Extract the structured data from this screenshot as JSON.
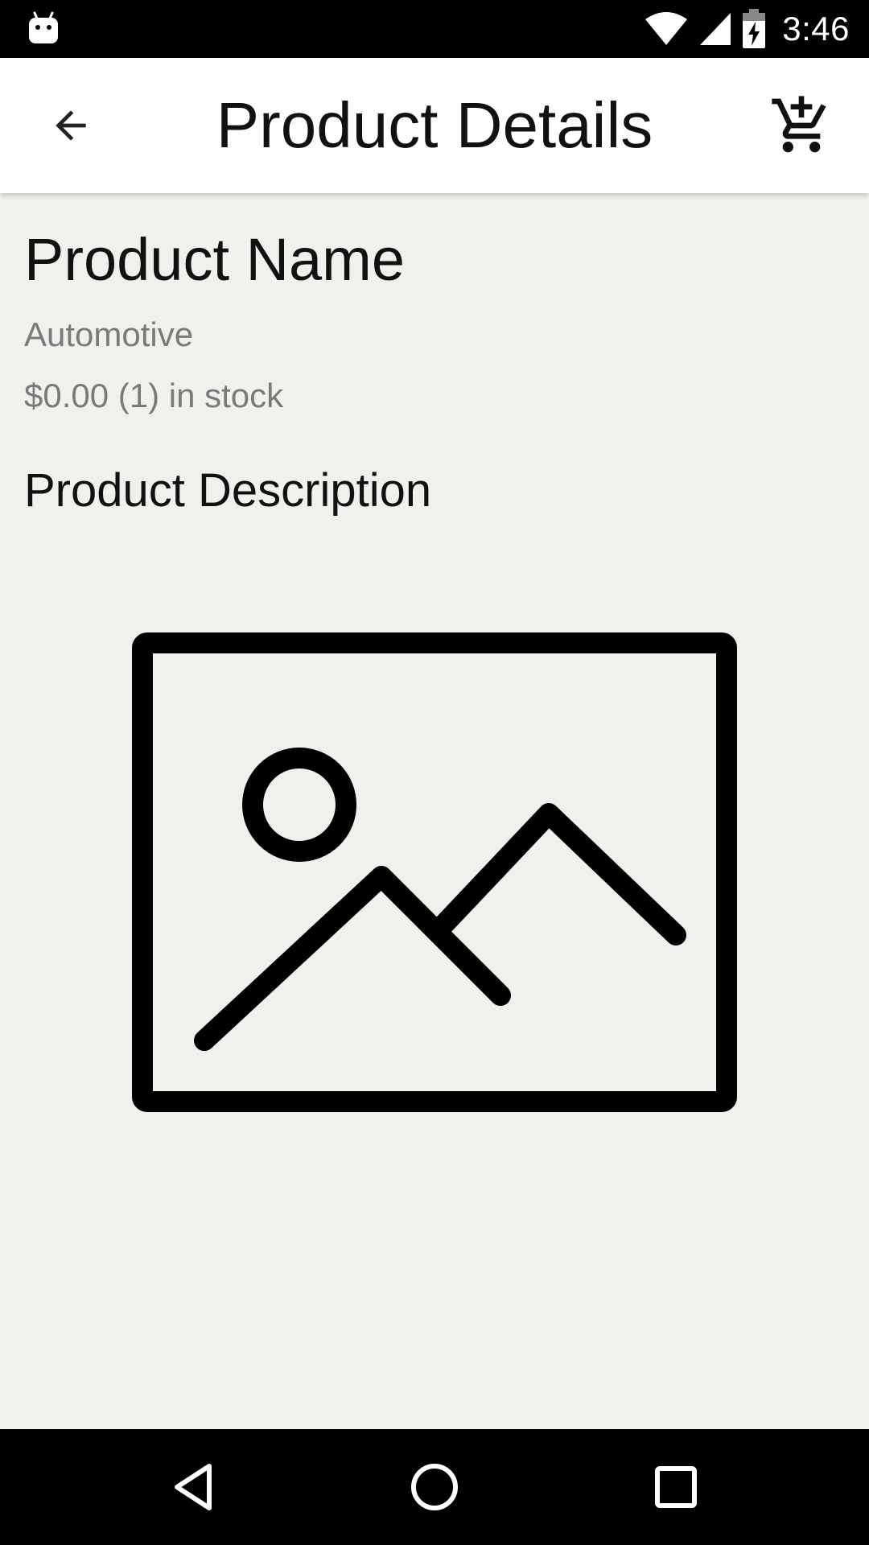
{
  "status_bar": {
    "time": "3:46",
    "icons": [
      "android-notification-icon",
      "wifi-icon",
      "cell-signal-icon",
      "battery-charging-icon"
    ]
  },
  "app_bar": {
    "title": "Product Details",
    "back_icon": "arrow-back-icon",
    "cart_icon": "add-shopping-cart-icon"
  },
  "product": {
    "name": "Product Name",
    "category": "Automotive",
    "price_stock": "$0.00 (1) in stock",
    "description_label": "Product Description",
    "image_icon": "image-placeholder-icon"
  },
  "nav_bar": {
    "icons": [
      "nav-back-icon",
      "nav-home-icon",
      "nav-recents-icon"
    ]
  },
  "colors": {
    "status_bar": "#000000",
    "app_bar": "#ffffff",
    "background": "#f1f0ed",
    "primary_text": "#111111",
    "secondary_text": "#7a7a7a",
    "nav_bar": "#000000"
  }
}
